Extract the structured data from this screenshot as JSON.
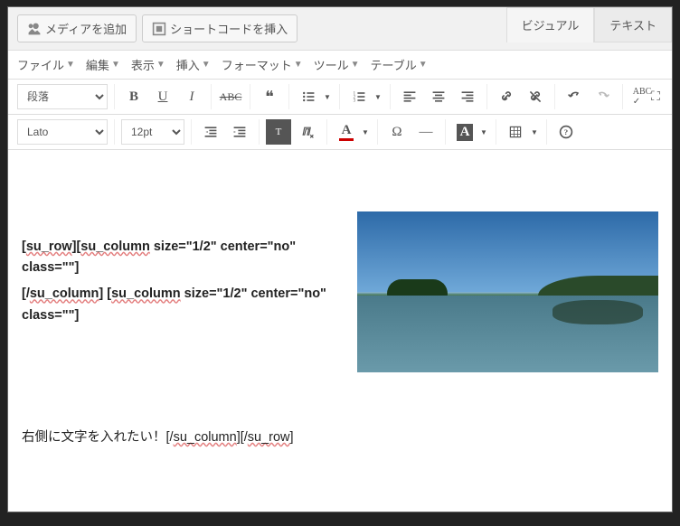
{
  "header": {
    "media_button": "メディアを追加",
    "shortcode_button": "ショートコードを挿入",
    "tabs": {
      "visual": "ビジュアル",
      "text": "テキスト"
    }
  },
  "menus": {
    "file": "ファイル",
    "edit": "編集",
    "view": "表示",
    "insert": "挿入",
    "format": "フォーマット",
    "tool": "ツール",
    "table": "テーブル"
  },
  "toolbar1": {
    "paragraph": "段落"
  },
  "toolbar2": {
    "font": "Lato",
    "size": "12pt"
  },
  "content": {
    "l1a": "su_row",
    "l1b": "su_column",
    "l1c": " size=\"1/2\" center=\"no\" class=\"\"]",
    "l2a": "su_column",
    "l2b": "] [",
    "l2c": "su_column",
    "l2d": " size=\"1/2\" center=\"no\" class=\"\"]",
    "l3a": "右側に文字を入れたい！[/",
    "l3b": "su_column",
    "l3c": "][/",
    "l3d": "su_row",
    "l3e": "]"
  }
}
